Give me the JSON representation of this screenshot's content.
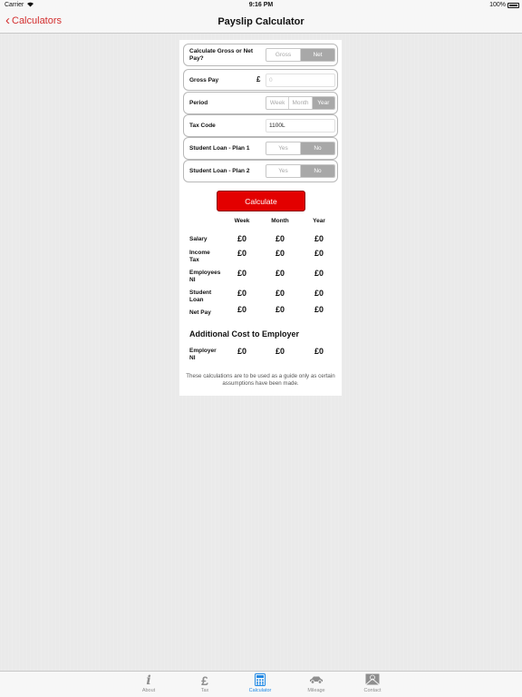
{
  "status": {
    "carrier": "Carrier",
    "time": "9:16 PM",
    "battery": "100%"
  },
  "nav": {
    "back_label": "Calculators",
    "title": "Payslip Calculator"
  },
  "form": {
    "calc_type": {
      "label": "Calculate Gross or Net Pay?",
      "options": [
        "Gross",
        "Net"
      ],
      "selected": "Net"
    },
    "gross_pay": {
      "label": "Gross Pay",
      "prefix": "£",
      "placeholder": "0"
    },
    "period": {
      "label": "Period",
      "options": [
        "Week",
        "Month",
        "Year"
      ],
      "selected": "Year"
    },
    "tax_code": {
      "label": "Tax Code",
      "value": "1100L"
    },
    "student_loan_1": {
      "label": "Student Loan - Plan 1",
      "options": [
        "Yes",
        "No"
      ],
      "selected": "No"
    },
    "student_loan_2": {
      "label": "Student Loan - Plan 2",
      "options": [
        "Yes",
        "No"
      ],
      "selected": "No"
    }
  },
  "calculate_label": "Calculate",
  "results": {
    "columns": [
      "Week",
      "Month",
      "Year"
    ],
    "rows": [
      {
        "label": "Salary",
        "values": [
          "£0",
          "£0",
          "£0"
        ]
      },
      {
        "label": "Income Tax",
        "values": [
          "£0",
          "£0",
          "£0"
        ]
      },
      {
        "label": "Employees NI",
        "values": [
          "£0",
          "£0",
          "£0"
        ]
      },
      {
        "label": "Student Loan",
        "values": [
          "£0",
          "£0",
          "£0"
        ]
      },
      {
        "label": "Net Pay",
        "values": [
          "£0",
          "£0",
          "£0"
        ]
      }
    ]
  },
  "additional": {
    "title": "Additional Cost to Employer",
    "row": {
      "label": "Employer NI",
      "values": [
        "£0",
        "£0",
        "£0"
      ]
    }
  },
  "disclaimer": "These calculations are to be used as a guide only as certain assumptions have been made.",
  "tabs": [
    {
      "label": "About",
      "icon": "info-icon"
    },
    {
      "label": "Tax",
      "icon": "pound-icon"
    },
    {
      "label": "Calculator",
      "icon": "calculator-icon"
    },
    {
      "label": "Mileage",
      "icon": "car-icon"
    },
    {
      "label": "Contact",
      "icon": "envelope-icon"
    }
  ],
  "colors": {
    "accent_red": "#e30000",
    "tab_active": "#1e88e5",
    "back_red": "#d32f2f"
  }
}
